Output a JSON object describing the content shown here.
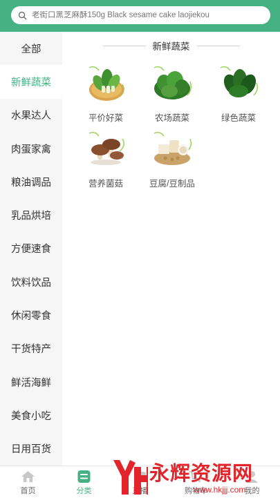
{
  "search": {
    "placeholder": "老街口黑芝麻酥150g Black sesame cake laojiekou"
  },
  "sidebar": {
    "items": [
      {
        "label": "全部"
      },
      {
        "label": "新鲜蔬菜"
      },
      {
        "label": "水果达人"
      },
      {
        "label": "肉蛋家禽"
      },
      {
        "label": "粮油调品"
      },
      {
        "label": "乳品烘培"
      },
      {
        "label": "方便速食"
      },
      {
        "label": "饮料饮品"
      },
      {
        "label": "休闲零食"
      },
      {
        "label": "干货特产"
      },
      {
        "label": "鲜活海鲜"
      },
      {
        "label": "美食小吃"
      },
      {
        "label": "日用百货"
      }
    ],
    "active_index": 1
  },
  "content": {
    "section_title": "新鲜蔬菜",
    "categories": [
      {
        "label": "平价好菜",
        "icon": "bok-choy-icon"
      },
      {
        "label": "农场蔬菜",
        "icon": "leafy-greens-icon"
      },
      {
        "label": "绿色蔬菜",
        "icon": "spinach-icon"
      },
      {
        "label": "营养菌菇",
        "icon": "mushroom-icon"
      },
      {
        "label": "豆腐/豆制品",
        "icon": "tofu-icon"
      }
    ]
  },
  "tabbar": {
    "tabs": [
      {
        "label": "首页",
        "icon": "home-icon"
      },
      {
        "label": "分类",
        "icon": "category-icon"
      },
      {
        "label": "直播",
        "icon": "live-icon"
      },
      {
        "label": "购物车",
        "icon": "cart-icon"
      },
      {
        "label": "我的",
        "icon": "profile-icon"
      }
    ],
    "active_index": 1
  },
  "watermark": {
    "brand": "永辉资源网",
    "url": "www.hkjjj.com"
  },
  "colors": {
    "accent": "#46b284",
    "watermark": "#e3242b"
  }
}
